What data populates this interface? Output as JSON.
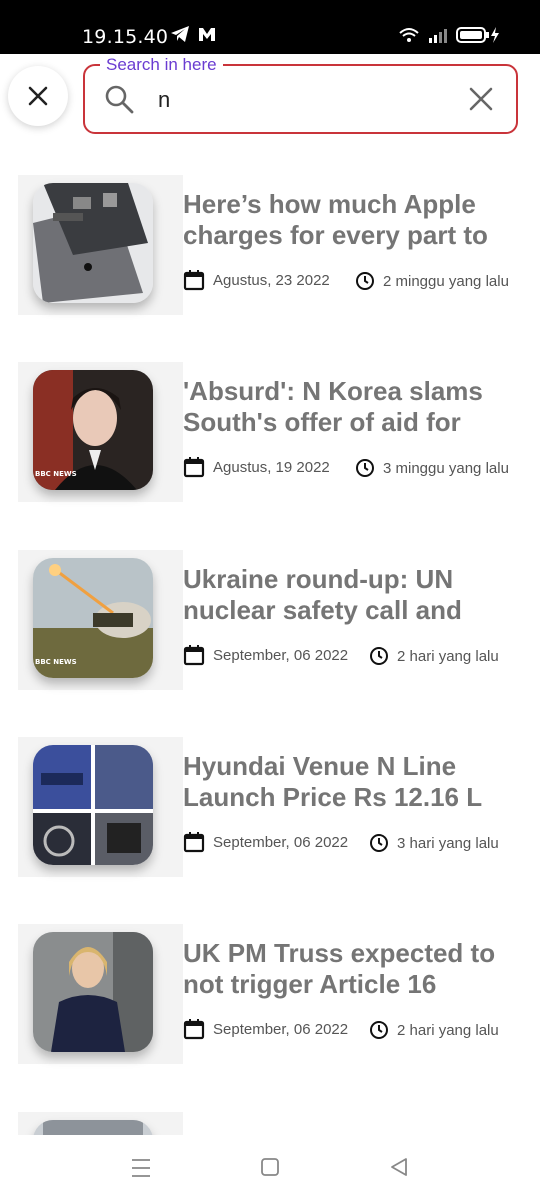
{
  "status_bar": {
    "time": "19.15.40"
  },
  "search": {
    "label": "Search in here",
    "value": "n"
  },
  "news": [
    {
      "title": "Here’s how much Apple charges for every part to",
      "date": "Agustus, 23 2022",
      "ago": "2 minggu yang lalu"
    },
    {
      "title": "'Absurd': N Korea slams South's offer of aid for",
      "date": "Agustus, 19 2022",
      "ago": "3 minggu yang lalu"
    },
    {
      "title": "Ukraine round-up: UN nuclear safety call and",
      "date": "September, 06 2022",
      "ago": "2 hari yang lalu"
    },
    {
      "title": "Hyundai Venue N Line Launch Price Rs 12.16 L",
      "date": "September, 06 2022",
      "ago": "3 hari yang lalu"
    },
    {
      "title": "UK PM Truss expected to not trigger Article 16",
      "date": "September, 06 2022",
      "ago": "2 hari yang lalu"
    }
  ],
  "thumb_badge": "BBC NEWS",
  "colors": {
    "accent_border": "#c9343a",
    "label": "#6a3cd1",
    "title": "#757575"
  }
}
